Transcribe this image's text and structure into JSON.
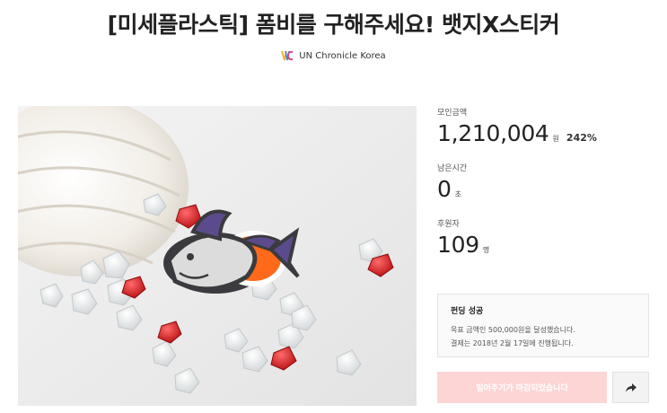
{
  "project": {
    "title": "[미세플라스틱] 폼비를 구해주세요! 뱃지X스티커",
    "creator_name": "UN Chronicle Korea",
    "hero_image_alt": "상어 모양 에나멜 뱃지와 조개 껍데기, 구슬"
  },
  "stats": {
    "amount_label": "모인금액",
    "amount_value": "1,210,004",
    "amount_unit": "원",
    "amount_percent": "242%",
    "time_label": "남은시간",
    "time_value": "0",
    "time_unit": "초",
    "backers_label": "후원자",
    "backers_value": "109",
    "backers_unit": "명"
  },
  "result": {
    "title": "펀딩 성공",
    "line1": "목표 금액인 500,000원을 달성했습니다.",
    "line2": "결제는 2018년 2월 17일에 진행됩니다."
  },
  "actions": {
    "closed_label": "밀어주기가 마감되었습니다",
    "share_icon": "share-icon"
  },
  "colors": {
    "closed_button_bg": "#fdd5d5",
    "brand_red": "#fa6462"
  }
}
